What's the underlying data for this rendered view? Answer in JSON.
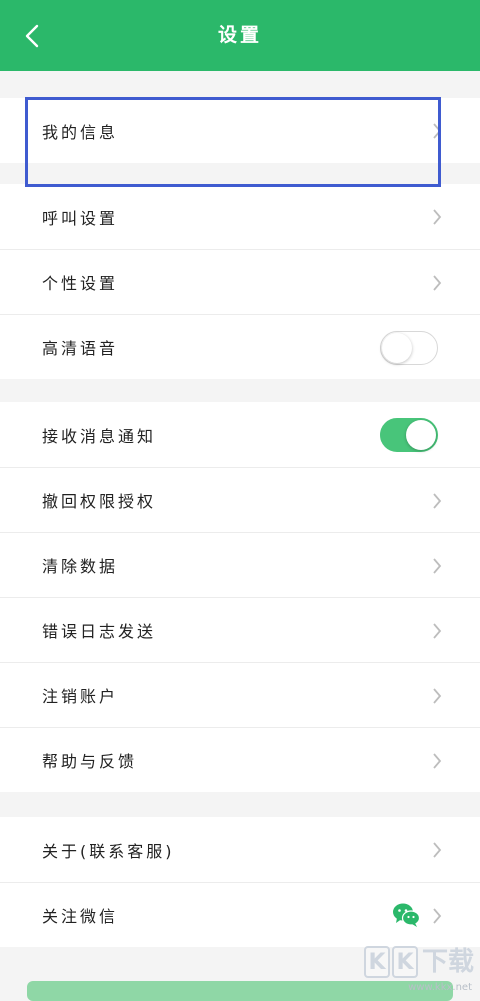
{
  "header": {
    "title": "设置",
    "back_icon": "chevron-left-icon",
    "background_color": "#2bb86a"
  },
  "groups": [
    {
      "items": [
        {
          "label": "我的信息",
          "control": "chevron"
        }
      ]
    },
    {
      "items": [
        {
          "label": "呼叫设置",
          "control": "chevron"
        },
        {
          "label": "个性设置",
          "control": "chevron"
        },
        {
          "label": "高清语音",
          "control": "toggle",
          "toggle_on": false
        }
      ]
    },
    {
      "items": [
        {
          "label": "接收消息通知",
          "control": "toggle",
          "toggle_on": true
        },
        {
          "label": "撤回权限授权",
          "control": "chevron"
        },
        {
          "label": "清除数据",
          "control": "chevron"
        },
        {
          "label": "错误日志发送",
          "control": "chevron"
        },
        {
          "label": "注销账户",
          "control": "chevron"
        },
        {
          "label": "帮助与反馈",
          "control": "chevron"
        }
      ]
    },
    {
      "items": [
        {
          "label": "关于(联系客服)",
          "control": "chevron"
        },
        {
          "label": "关注微信",
          "control": "chevron",
          "icon": "wechat-icon"
        }
      ]
    }
  ],
  "toggle_on_color": "#48c57a",
  "highlight_color": "#3f5bd0",
  "watermark": {
    "letter1": "K",
    "letter2": "K",
    "cn": "下载",
    "url": "www.kkx.net"
  }
}
